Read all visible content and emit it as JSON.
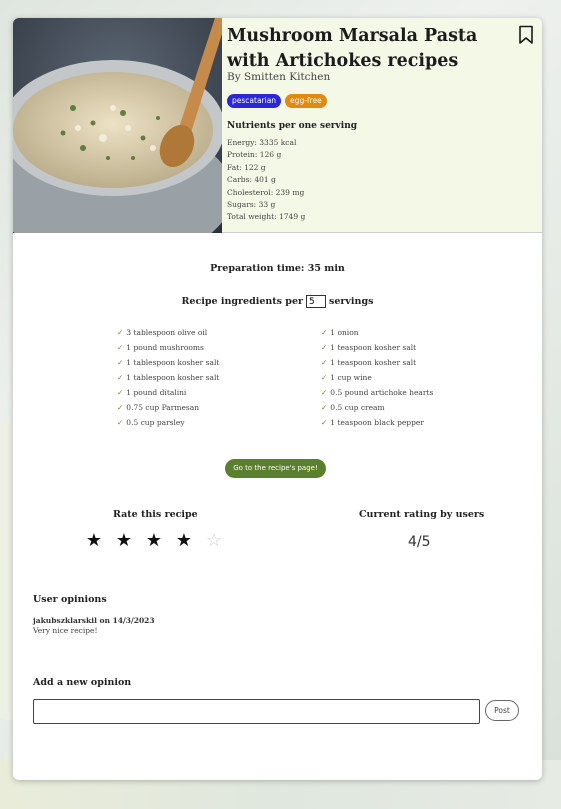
{
  "recipe": {
    "title": "Mushroom Marsala Pasta with Artichokes recipes",
    "author": "By Smitten Kitchen",
    "labels": [
      {
        "text": "pescatarian",
        "color": "#2b27d6"
      },
      {
        "text": "egg-free",
        "color": "#e08a10"
      }
    ]
  },
  "nutrients": {
    "title": "Nutrients per one serving",
    "items": [
      "Energy: 3335 kcal",
      "Protein: 126 g",
      "Fat: 122 g",
      "Carbs: 401 g",
      "Cholesterol: 239 mg",
      "Sugars: 33 g",
      "Total weight: 1749 g"
    ]
  },
  "prep_time": "Preparation time: 35 min",
  "servings": {
    "label_before": "Recipe ingredients per",
    "value": "5",
    "label_after": "servings"
  },
  "ingredients": {
    "check_glyph": "✓",
    "left": [
      "3 tablespoon olive oil",
      "1 pound mushrooms",
      "1 tablespoon kosher salt",
      "1 tablespoon kosher salt",
      "1 pound ditalini",
      "0.75 cup Parmesan",
      "0.5 cup parsley"
    ],
    "right": [
      "1 onion",
      "1 teaspoon kosher salt",
      "1 teaspoon kosher salt",
      "1 cup wine",
      "0.5 pound artichoke hearts",
      "0.5 cup cream",
      "1 teaspoon black pepper"
    ]
  },
  "go_button": "Go to the recipe's page!",
  "rating": {
    "rate_title": "Rate this recipe",
    "user_stars": 4,
    "max_stars": 5,
    "current_title": "Current rating by users",
    "current_value": "4/5"
  },
  "opinions": {
    "title": "User opinions",
    "items": [
      {
        "author": "jakubszklarskil on 14/3/2023",
        "text": "Very nice recipe!"
      }
    ]
  },
  "add_opinion": {
    "title": "Add a new opinion",
    "placeholder": "",
    "post_label": "Post"
  },
  "colors": {
    "accent": "#5a7f2d",
    "header_bg": "#f4f8e6"
  }
}
